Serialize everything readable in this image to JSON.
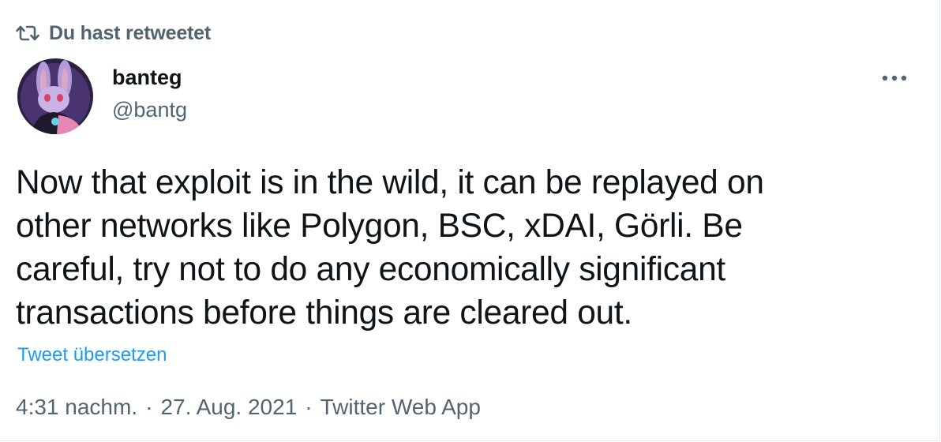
{
  "header": {
    "retweet_label": "Du hast retweetet",
    "retweet_icon": "retweet-icon"
  },
  "author": {
    "display_name": "banteg",
    "handle": "@bantg",
    "avatar_icon": "avatar"
  },
  "menu": {
    "more_icon": "more-icon"
  },
  "tweet": {
    "text": "Now that exploit is in the wild, it can be replayed on\nother networks like Polygon, BSC, xDAI, Görli. Be\ncareful, try not to do any economically significant\ntransactions before things are cleared out.",
    "translate_label": "Tweet übersetzen"
  },
  "meta": {
    "time": "4:31 nachm.",
    "separator": "·",
    "date": "27. Aug. 2021",
    "source": "Twitter Web App"
  },
  "colors": {
    "text": "#0f1419",
    "secondary": "#536471",
    "link": "#1d9bf0"
  }
}
